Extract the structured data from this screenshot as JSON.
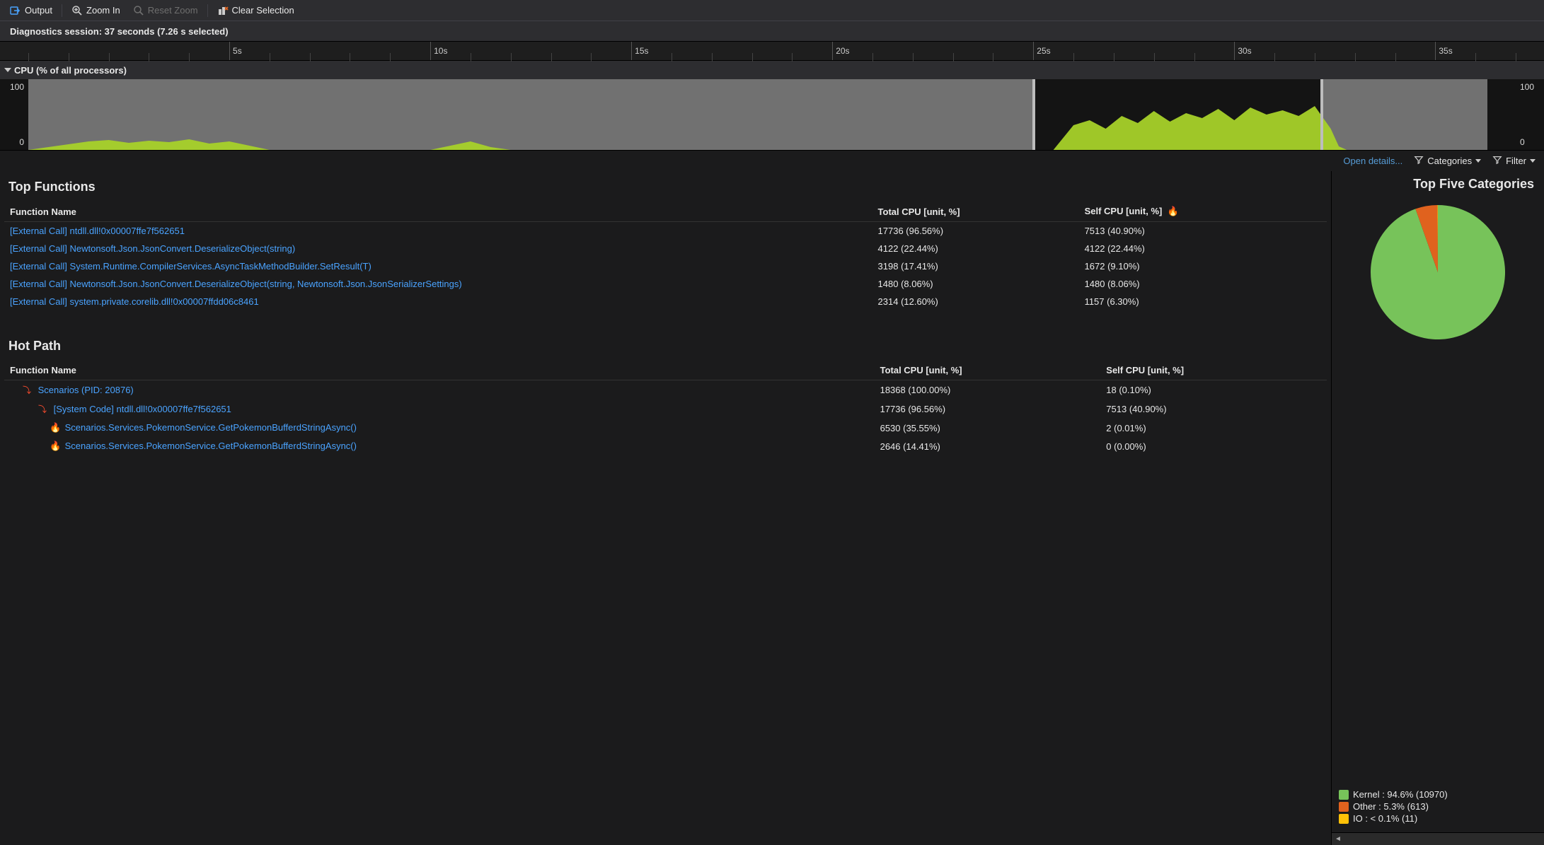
{
  "toolbar": {
    "output": "Output",
    "zoom_in": "Zoom In",
    "reset_zoom": "Reset Zoom",
    "clear_sel": "Clear Selection"
  },
  "session_line": "Diagnostics session: 37 seconds (7.26 s selected)",
  "cpu_header": "CPU (% of all processors)",
  "axis": {
    "max": "100",
    "min": "0"
  },
  "ruler": {
    "ticks": [
      "5s",
      "10s",
      "15s",
      "20s",
      "25s",
      "30s",
      "35s"
    ]
  },
  "dropdowns": {
    "open_details": "Open details...",
    "categories": "Categories",
    "filter": "Filter"
  },
  "top_functions": {
    "title": "Top Functions",
    "col_fn": "Function Name",
    "col_total": "Total CPU [unit, %]",
    "col_self": "Self CPU [unit, %]",
    "rows": [
      {
        "fn": "[External Call] ntdll.dll!0x00007ffe7f562651",
        "total": "17736 (96.56%)",
        "self": "7513 (40.90%)"
      },
      {
        "fn": "[External Call] Newtonsoft.Json.JsonConvert.DeserializeObject<T>(string)",
        "total": "4122 (22.44%)",
        "self": "4122 (22.44%)"
      },
      {
        "fn": "[External Call] System.Runtime.CompilerServices.AsyncTaskMethodBuilder<T>.SetResult(T)",
        "total": "3198 (17.41%)",
        "self": "1672 (9.10%)"
      },
      {
        "fn": "[External Call] Newtonsoft.Json.JsonConvert.DeserializeObject<T>(string, Newtonsoft.Json.JsonSerializerSettings)",
        "total": "1480 (8.06%)",
        "self": "1480 (8.06%)"
      },
      {
        "fn": "[External Call] system.private.corelib.dll!0x00007ffdd06c8461",
        "total": "2314 (12.60%)",
        "self": "1157 (6.30%)"
      }
    ]
  },
  "hot_path": {
    "title": "Hot Path",
    "col_fn": "Function Name",
    "col_total": "Total CPU [unit, %]",
    "col_self": "Self CPU [unit, %]",
    "rows": [
      {
        "indent": 1,
        "icon": "hotpath",
        "fn": "Scenarios (PID: 20876)",
        "total": "18368 (100.00%)",
        "self": "18 (0.10%)"
      },
      {
        "indent": 2,
        "icon": "hotpath",
        "fn": "[System Code] ntdll.dll!0x00007ffe7f562651",
        "total": "17736 (96.56%)",
        "self": "7513 (40.90%)"
      },
      {
        "indent": 3,
        "icon": "flame",
        "fn": "Scenarios.Services.PokemonService.GetPokemonBufferdStringAsync()",
        "total": "6530 (35.55%)",
        "self": "2 (0.01%)"
      },
      {
        "indent": 3,
        "icon": "flame",
        "fn": "Scenarios.Services.PokemonService.GetPokemonBufferdStringAsync()",
        "total": "2646 (14.41%)",
        "self": "0 (0.00%)"
      }
    ]
  },
  "top_categories": {
    "title": "Top Five Categories",
    "legend": [
      {
        "label": "Kernel : 94.6% (10970)",
        "color": "#77c35a"
      },
      {
        "label": "Other : 5.3% (613)",
        "color": "#e0621e"
      },
      {
        "label": "IO : < 0.1% (11)",
        "color": "#ffc107"
      }
    ]
  },
  "chart_data": {
    "type": "area",
    "title": "CPU (% of all processors)",
    "xlabel": "seconds",
    "ylabel": "CPU %",
    "xlim": [
      0,
      37
    ],
    "ylim": [
      0,
      100
    ],
    "selection": [
      25.5,
      32.8
    ],
    "series": [
      {
        "name": "CPU %",
        "points": [
          [
            0,
            0
          ],
          [
            1,
            8
          ],
          [
            1.5,
            12
          ],
          [
            2,
            14
          ],
          [
            2.5,
            10
          ],
          [
            3,
            13
          ],
          [
            3.5,
            11
          ],
          [
            4,
            15
          ],
          [
            4.5,
            9
          ],
          [
            5,
            12
          ],
          [
            6,
            0
          ],
          [
            7,
            0
          ],
          [
            8,
            0
          ],
          [
            10,
            0
          ],
          [
            10.5,
            6
          ],
          [
            11,
            12
          ],
          [
            11.5,
            4
          ],
          [
            12,
            0
          ],
          [
            20,
            0
          ],
          [
            25,
            0
          ],
          [
            25.5,
            0
          ],
          [
            26,
            35
          ],
          [
            26.4,
            42
          ],
          [
            26.8,
            30
          ],
          [
            27.2,
            48
          ],
          [
            27.6,
            38
          ],
          [
            28,
            55
          ],
          [
            28.4,
            40
          ],
          [
            28.8,
            52
          ],
          [
            29.2,
            45
          ],
          [
            29.6,
            58
          ],
          [
            30,
            42
          ],
          [
            30.4,
            60
          ],
          [
            30.8,
            50
          ],
          [
            31.2,
            56
          ],
          [
            31.6,
            48
          ],
          [
            32,
            62
          ],
          [
            32.4,
            30
          ],
          [
            32.6,
            5
          ],
          [
            32.8,
            0
          ],
          [
            37,
            0
          ]
        ]
      }
    ]
  },
  "pie_data": {
    "type": "pie",
    "slices": [
      {
        "label": "Kernel",
        "pct": 94.6,
        "value": 10970,
        "color": "#77c35a"
      },
      {
        "label": "Other",
        "pct": 5.3,
        "value": 613,
        "color": "#e0621e"
      },
      {
        "label": "IO",
        "pct": 0.1,
        "value": 11,
        "color": "#ffc107"
      }
    ]
  }
}
